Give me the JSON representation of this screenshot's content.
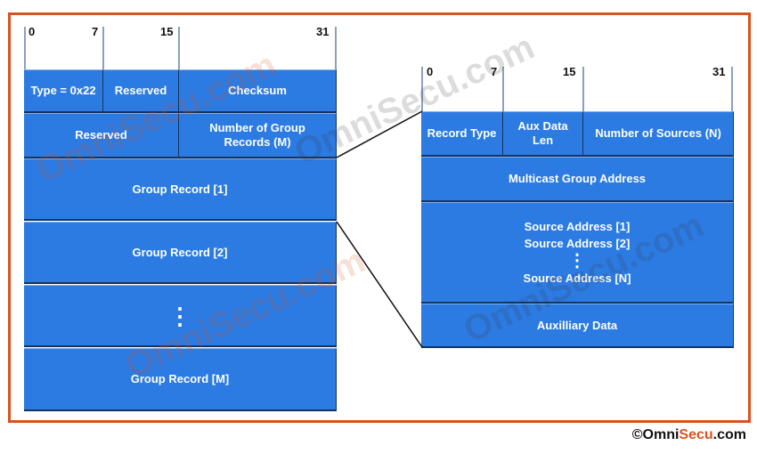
{
  "left_table": {
    "bit_labels": [
      "0",
      "7",
      "15",
      "31"
    ],
    "type": "Type = 0x22",
    "reserved_1": "Reserved",
    "checksum": "Checksum",
    "reserved_2": "Reserved",
    "num_group_records": "Number of Group Records (M)",
    "group_record_1": "Group Record [1]",
    "group_record_2": "Group Record [2]",
    "ellipsis": "⋮",
    "group_record_m": "Group Record [M]"
  },
  "right_table": {
    "bit_labels": [
      "0",
      "7",
      "15",
      "31"
    ],
    "record_type": "Record Type",
    "aux_data_len": "Aux Data Len",
    "num_sources": "Number of Sources (N)",
    "multicast_group_address": "Multicast Group Address",
    "source_address_1": "Source Address [1]",
    "source_address_2": "Source Address [2]",
    "ellipsis": "⋮",
    "source_address_n": "Source Address [N]",
    "auxiliary_data": "Auxilliary Data"
  },
  "copyright": {
    "symbol": "©",
    "omni": "Omni",
    "secu": "Secu",
    "com": ".com"
  },
  "watermark": "OmniSecu.com",
  "colors": {
    "cell": "#2b7be3",
    "frame": "#d9531e"
  }
}
